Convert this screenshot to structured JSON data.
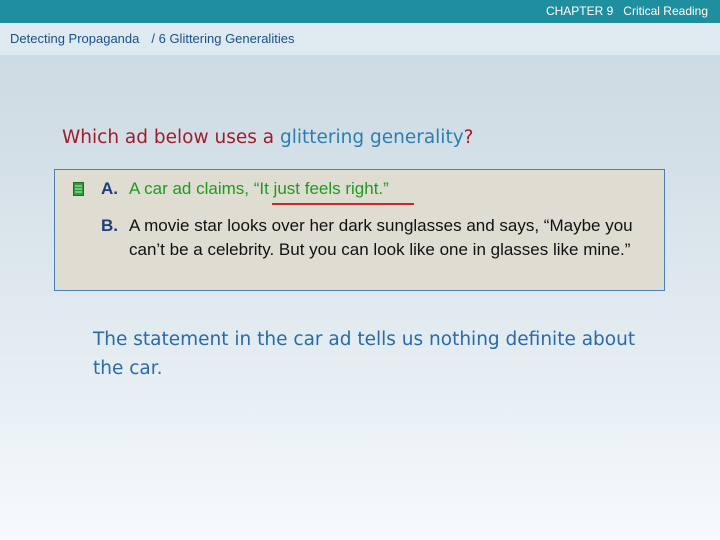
{
  "header": {
    "chapter": "CHAPTER 9",
    "subject": "Critical Reading"
  },
  "breadcrumb": {
    "section": "Detecting Propaganda",
    "page": "/ 6 Glittering Generalities"
  },
  "question": {
    "prefix": "Which ad below uses a ",
    "term": "glittering generality",
    "suffix": "?"
  },
  "options": [
    {
      "letter": "A.",
      "text": "A car ad claims, “It just feels right.”"
    },
    {
      "letter": "B.",
      "text": "A movie star looks over her dark sunglasses and says, “Maybe you can’t be a celebrity. But you can look like one in glasses like mine.”"
    }
  ],
  "explanation": "The statement in the car ad tells us nothing definite about the car.",
  "icons": {
    "selected_answer": "document-icon"
  },
  "colors": {
    "top_bar": "#1f8e9f",
    "question": "#a01c2a",
    "term": "#2b7fb0",
    "correct_answer": "#1f9a1f",
    "underline": "#c42a2a",
    "explanation": "#2a6aa8"
  }
}
